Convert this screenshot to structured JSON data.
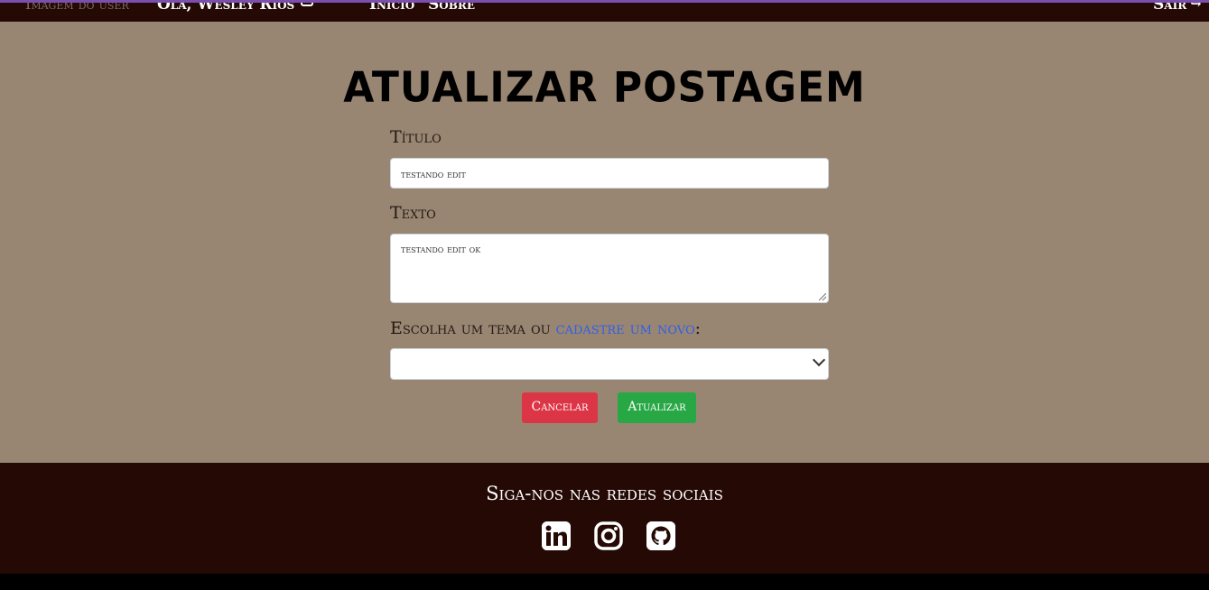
{
  "navbar": {
    "avatar_alt": "Imagem do user",
    "greeting": "Olá, Wesley Rios",
    "home": "Início",
    "about": "Sobre",
    "logout": "Sair",
    "colors": {
      "background": "#240905",
      "accent": "#7b4fb0"
    }
  },
  "form": {
    "page_title": "Atualizar postagem",
    "title_label": "Título",
    "title_value": "testando edit",
    "text_label": "Texto",
    "text_value": "testando edit ok",
    "theme_label_prefix": "Escolha um tema ou ",
    "theme_link": "cadastre um novo",
    "theme_label_suffix": ":",
    "theme_selected": "",
    "cancel_label": "Cancelar",
    "update_label": "Atualizar",
    "colors": {
      "background": "#998672",
      "cancel": "#dc3545",
      "update": "#28a745",
      "link": "#2f5fe8"
    }
  },
  "footer": {
    "title": "Siga-nos nas redes sociais",
    "icons": [
      "linkedin-icon",
      "instagram-icon",
      "github-icon"
    ],
    "colors": {
      "background": "#240905"
    }
  }
}
